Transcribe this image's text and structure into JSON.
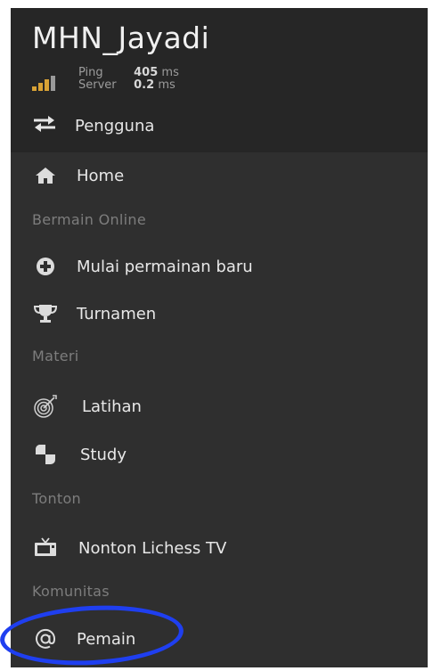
{
  "header": {
    "username": "MHN_Jayadi",
    "ping": {
      "label": "Ping",
      "value": "405",
      "unit": "ms"
    },
    "server": {
      "label": "Server",
      "value": "0.2",
      "unit": "ms"
    },
    "switch_label": "Pengguna",
    "signal_colors": [
      "#d8a235",
      "#d8a235",
      "#d8a235",
      "#8a8a8a"
    ]
  },
  "menu": {
    "home": "Home",
    "section_play": "Bermain Online",
    "new_game": "Mulai permainan baru",
    "tournament": "Turnamen",
    "section_learn": "Materi",
    "practice": "Latihan",
    "study": "Study",
    "section_watch": "Tonton",
    "tv": "Nonton Lichess TV",
    "section_community": "Komunitas",
    "players": "Pemain"
  },
  "annotation": {
    "color": "#1f3ff0"
  }
}
